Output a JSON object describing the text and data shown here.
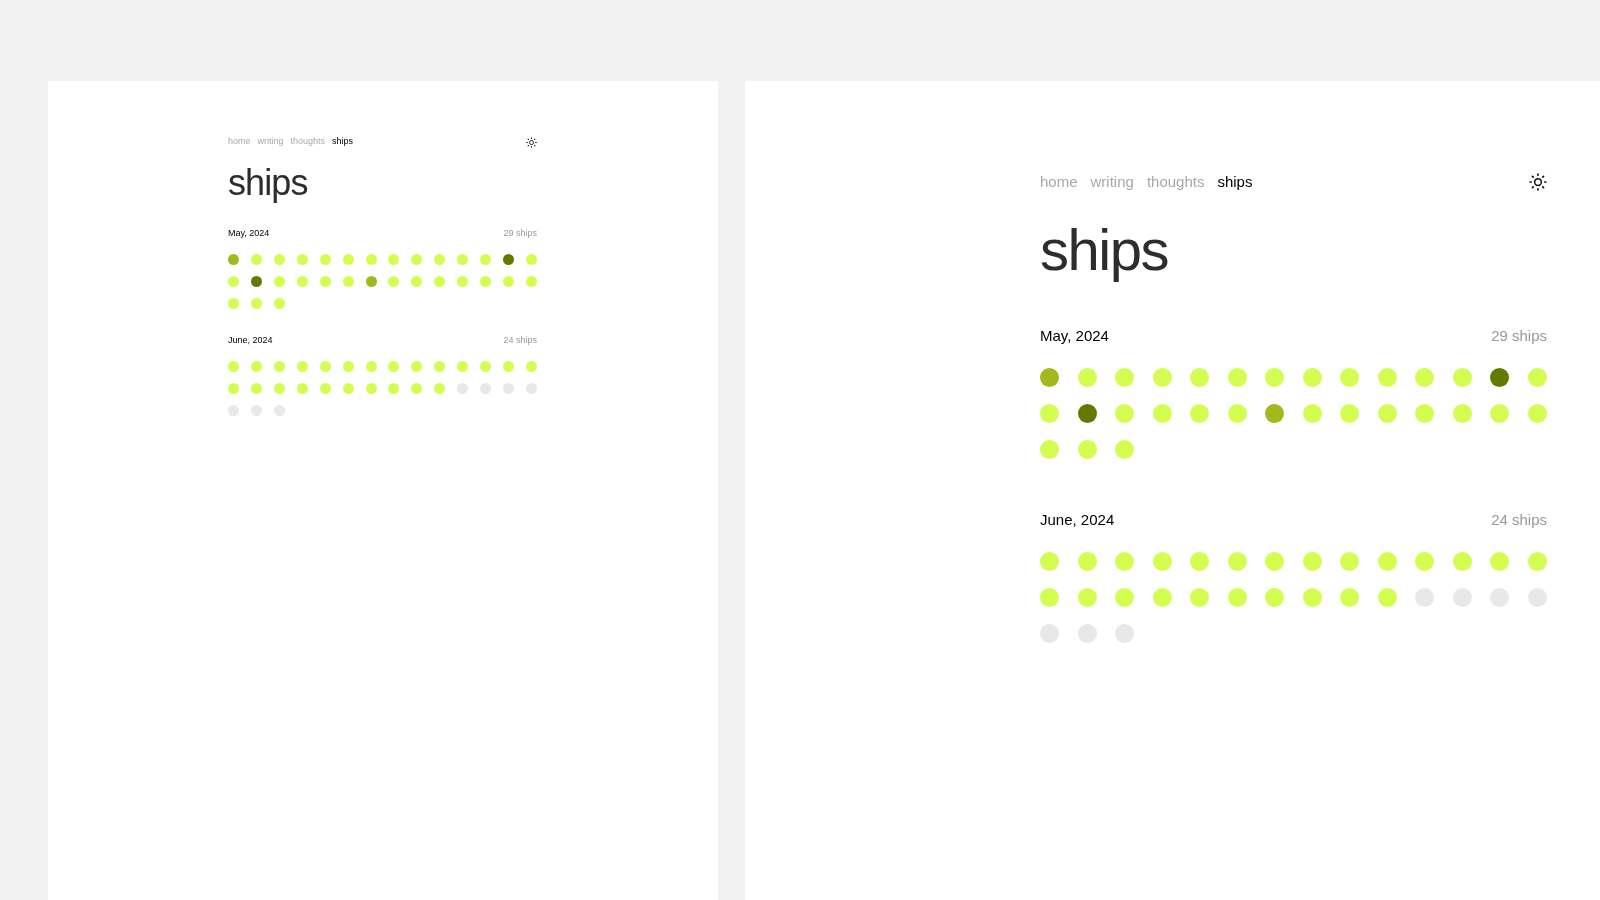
{
  "panels": [
    {
      "kind": "small",
      "nav": [
        {
          "label": "home",
          "selected": false
        },
        {
          "label": "writing",
          "selected": false
        },
        {
          "label": "thoughts",
          "selected": false
        },
        {
          "label": "ships",
          "selected": true
        }
      ],
      "title": "ships",
      "months": [
        {
          "label": "May, 2024",
          "count": "29 ships",
          "dots": [
            {
              "color": "#a3b81c"
            },
            {
              "color": "#d4fd52"
            },
            {
              "color": "#d4fd52"
            },
            {
              "color": "#d4fd52"
            },
            {
              "color": "#d4fd52"
            },
            {
              "color": "#d4fd52"
            },
            {
              "color": "#d4fd52"
            },
            {
              "color": "#d4fd52"
            },
            {
              "color": "#d4fd52"
            },
            {
              "color": "#d4fd52"
            },
            {
              "color": "#d4fd52"
            },
            {
              "color": "#d4fd52"
            },
            {
              "color": "#627a00"
            },
            {
              "color": "#d4fd52"
            },
            {
              "color": "#d4fd52"
            },
            {
              "color": "#627a00"
            },
            {
              "color": "#d4fd52"
            },
            {
              "color": "#d4fd52"
            },
            {
              "color": "#d4fd52"
            },
            {
              "color": "#d4fd52"
            },
            {
              "color": "#a3b81c"
            },
            {
              "color": "#d4fd52"
            },
            {
              "color": "#d4fd52"
            },
            {
              "color": "#d4fd52"
            },
            {
              "color": "#d4fd52"
            },
            {
              "color": "#d4fd52"
            },
            {
              "color": "#d4fd52"
            },
            {
              "color": "#d4fd52"
            },
            {
              "color": "#d4fd52"
            },
            {
              "color": "#d4fd52"
            },
            {
              "color": "#d4fd52"
            }
          ]
        },
        {
          "label": "June, 2024",
          "count": "24 ships",
          "dots": [
            {
              "color": "#d4fd52"
            },
            {
              "color": "#d4fd52"
            },
            {
              "color": "#d4fd52"
            },
            {
              "color": "#d4fd52"
            },
            {
              "color": "#d4fd52"
            },
            {
              "color": "#d4fd52"
            },
            {
              "color": "#d4fd52"
            },
            {
              "color": "#d4fd52"
            },
            {
              "color": "#d4fd52"
            },
            {
              "color": "#d4fd52"
            },
            {
              "color": "#d4fd52"
            },
            {
              "color": "#d4fd52"
            },
            {
              "color": "#d4fd52"
            },
            {
              "color": "#d4fd52"
            },
            {
              "color": "#d4fd52"
            },
            {
              "color": "#d4fd52"
            },
            {
              "color": "#d4fd52"
            },
            {
              "color": "#d4fd52"
            },
            {
              "color": "#d4fd52"
            },
            {
              "color": "#d4fd52"
            },
            {
              "color": "#d4fd52"
            },
            {
              "color": "#d4fd52"
            },
            {
              "color": "#d4fd52"
            },
            {
              "color": "#d4fd52"
            },
            {
              "color": "#e8e8e8"
            },
            {
              "color": "#e8e8e8"
            },
            {
              "color": "#e8e8e8"
            },
            {
              "color": "#e8e8e8"
            },
            {
              "color": "#e8e8e8"
            },
            {
              "color": "#e8e8e8"
            },
            {
              "color": "#e8e8e8"
            }
          ]
        }
      ]
    },
    {
      "kind": "large",
      "nav": [
        {
          "label": "home",
          "selected": false
        },
        {
          "label": "writing",
          "selected": false
        },
        {
          "label": "thoughts",
          "selected": false
        },
        {
          "label": "ships",
          "selected": true
        }
      ],
      "title": "ships",
      "months": [
        {
          "label": "May, 2024",
          "count": "29 ships",
          "dots": [
            {
              "color": "#a3b81c"
            },
            {
              "color": "#d4fd52"
            },
            {
              "color": "#d4fd52"
            },
            {
              "color": "#d4fd52"
            },
            {
              "color": "#d4fd52"
            },
            {
              "color": "#d4fd52"
            },
            {
              "color": "#d4fd52"
            },
            {
              "color": "#d4fd52"
            },
            {
              "color": "#d4fd52"
            },
            {
              "color": "#d4fd52"
            },
            {
              "color": "#d4fd52"
            },
            {
              "color": "#d4fd52"
            },
            {
              "color": "#627a00"
            },
            {
              "color": "#d4fd52"
            },
            {
              "color": "#d4fd52"
            },
            {
              "color": "#627a00"
            },
            {
              "color": "#d4fd52"
            },
            {
              "color": "#d4fd52"
            },
            {
              "color": "#d4fd52"
            },
            {
              "color": "#d4fd52"
            },
            {
              "color": "#a3b81c"
            },
            {
              "color": "#d4fd52"
            },
            {
              "color": "#d4fd52"
            },
            {
              "color": "#d4fd52"
            },
            {
              "color": "#d4fd52"
            },
            {
              "color": "#d4fd52"
            },
            {
              "color": "#d4fd52"
            },
            {
              "color": "#d4fd52"
            },
            {
              "color": "#d4fd52"
            },
            {
              "color": "#d4fd52"
            },
            {
              "color": "#d4fd52"
            }
          ]
        },
        {
          "label": "June, 2024",
          "count": "24 ships",
          "dots": [
            {
              "color": "#d4fd52"
            },
            {
              "color": "#d4fd52"
            },
            {
              "color": "#d4fd52"
            },
            {
              "color": "#d4fd52"
            },
            {
              "color": "#d4fd52"
            },
            {
              "color": "#d4fd52"
            },
            {
              "color": "#d4fd52"
            },
            {
              "color": "#d4fd52"
            },
            {
              "color": "#d4fd52"
            },
            {
              "color": "#d4fd52"
            },
            {
              "color": "#d4fd52"
            },
            {
              "color": "#d4fd52"
            },
            {
              "color": "#d4fd52"
            },
            {
              "color": "#d4fd52"
            },
            {
              "color": "#d4fd52"
            },
            {
              "color": "#d4fd52"
            },
            {
              "color": "#d4fd52"
            },
            {
              "color": "#d4fd52"
            },
            {
              "color": "#d4fd52"
            },
            {
              "color": "#d4fd52"
            },
            {
              "color": "#d4fd52"
            },
            {
              "color": "#d4fd52"
            },
            {
              "color": "#d4fd52"
            },
            {
              "color": "#d4fd52"
            },
            {
              "color": "#e8e8e8"
            },
            {
              "color": "#e8e8e8"
            },
            {
              "color": "#e8e8e8"
            },
            {
              "color": "#e8e8e8"
            },
            {
              "color": "#e8e8e8"
            },
            {
              "color": "#e8e8e8"
            },
            {
              "color": "#e8e8e8"
            }
          ]
        }
      ]
    }
  ]
}
